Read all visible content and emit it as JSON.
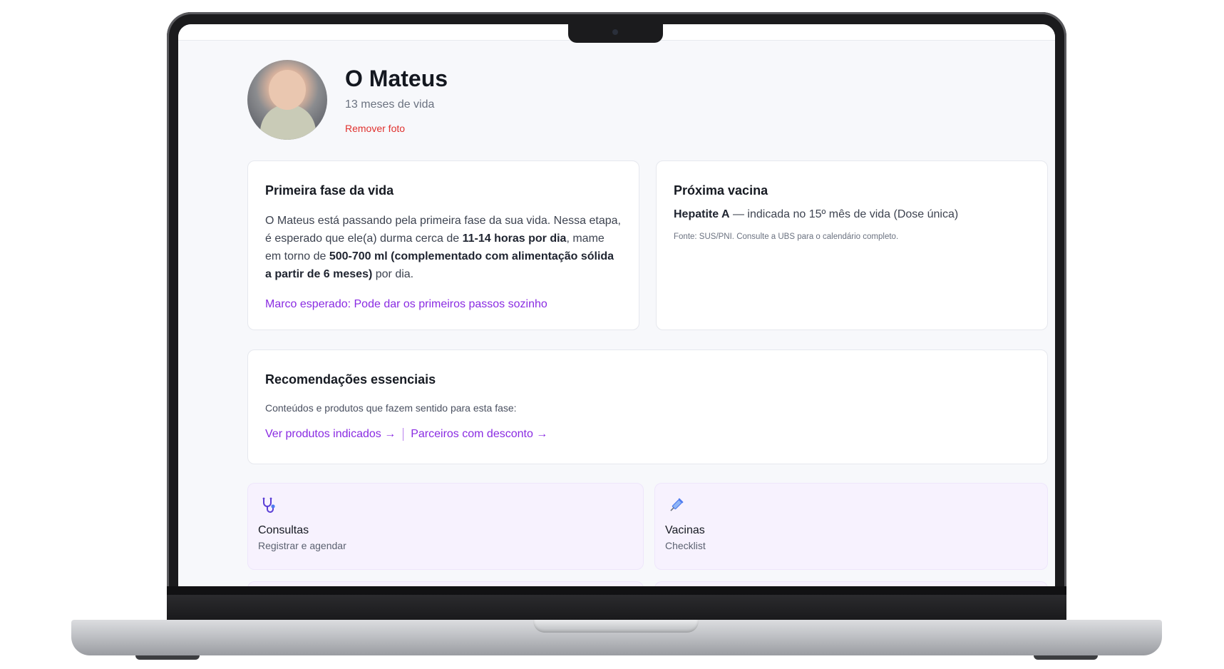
{
  "profile": {
    "name": "O Mateus",
    "age": "13 meses de vida",
    "remove_photo": "Remover foto"
  },
  "phase_card": {
    "title": "Primeira fase da vida",
    "text_1": "O Mateus está passando pela primeira fase da sua vida. Nessa etapa, é esperado que ele(a) durma cerca de ",
    "sleep": "11-14 horas por dia",
    "text_2": ", mame em torno de ",
    "feeding": "500-700 ml (complementado com alimentação sólida a partir de 6 meses)",
    "text_3": " por dia.",
    "milestone": "Marco esperado: Pode dar os primeiros passos sozinho"
  },
  "vaccine_card": {
    "title": "Próxima vacina",
    "vaccine_name": "Hepatite A",
    "vaccine_detail": " — indicada no 15º mês de vida (Dose única)",
    "source": "Fonte: SUS/PNI. Consulte a UBS para o calendário completo."
  },
  "recommendations": {
    "title": "Recomendações essenciais",
    "subtitle": "Conteúdos e produtos que fazem sentido para esta fase:",
    "link_products": "Ver produtos indicados →",
    "link_partners": "Parceiros com desconto →"
  },
  "tiles": [
    {
      "title": "Consultas",
      "subtitle": "Registrar e agendar",
      "icon": "stethoscope-icon"
    },
    {
      "title": "Vacinas",
      "subtitle": "Checklist",
      "icon": "syringe-icon"
    }
  ],
  "colors": {
    "accent": "#8a2be2",
    "danger": "#e0322f",
    "tile_bg": "#f7f2fe"
  }
}
